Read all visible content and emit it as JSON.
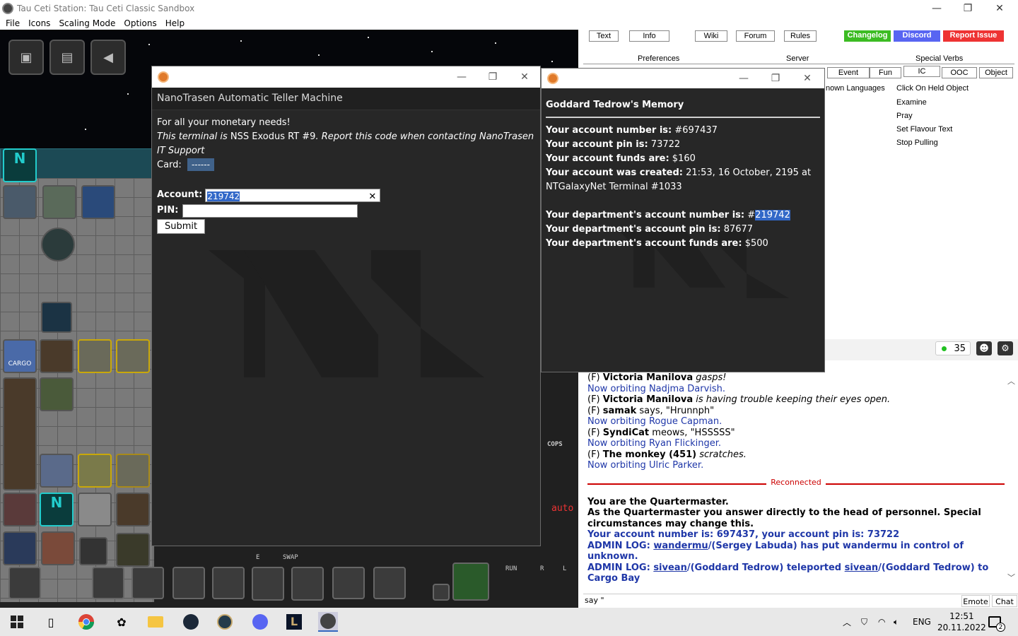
{
  "window": {
    "title": "Tau Ceti Station: Tau Ceti Classic Sandbox",
    "minimize": "—",
    "maximize": "❐",
    "close": "✕"
  },
  "menu": [
    "File",
    "Icons",
    "Scaling Mode",
    "Options",
    "Help"
  ],
  "game": {
    "cargo_label": "CARGO",
    "swap_label": "SWAP",
    "run_label": "RUN",
    "cops_label": "COPS",
    "auto_label": "auto",
    "e_label": "E",
    "r_label": "R",
    "l_label": "L"
  },
  "atm": {
    "header": "NanoTrasen Automatic Teller Machine",
    "line1": "For all your monetary needs!",
    "line2_italic_a": "This terminal is ",
    "line2_normal": "NSS Exodus RT #9",
    "line2_italic_b": ". Report this code when contacting NanoTrasen IT Support",
    "card_label": "Card:",
    "card_value": "------",
    "account_label": "Account:",
    "account_value": "219742",
    "pin_label": "PIN:",
    "pin_value": "",
    "clear_icon": "✕",
    "submit_label": "Submit"
  },
  "memory": {
    "title": "Goddard Tedrow's Memory",
    "account_number_label": "Your account number is:",
    "account_number": "#697437",
    "account_pin_label": "Your account pin is:",
    "account_pin": "73722",
    "account_funds_label": "Your account funds are:",
    "account_funds": "$160",
    "created_label": "Your account was created:",
    "created_value": "21:53, 16 October, 2195 at",
    "created_terminal": "NTGalaxyNet Terminal #1033",
    "dept_number_label": "Your department's account number is:",
    "dept_number_hash": "#",
    "dept_number": "219742",
    "dept_pin_label": "Your department's account pin is:",
    "dept_pin": "87677",
    "dept_funds_label": "Your department's account funds are:",
    "dept_funds": "$500"
  },
  "panel": {
    "top_buttons": [
      "Text",
      "Info",
      "Wiki",
      "Forum",
      "Rules"
    ],
    "changelog": "Changelog",
    "discord": "Discord",
    "report": "Report Issue",
    "tabs_row1": [
      "Preferences",
      "Server",
      "Special Verbs"
    ],
    "tabs_row2": [
      "Event",
      "Fun",
      "IC",
      "OOC",
      "Object"
    ],
    "known_languages": "nown Languages",
    "verbs": [
      "Click On Held Object",
      "Examine",
      "Pray",
      "Set Flavour Text",
      "Stop Pulling"
    ],
    "online_count": "35",
    "face_icon": "☻",
    "gear_icon": "⚙"
  },
  "chat": {
    "lines": [
      {
        "prefix": "(F) ",
        "name": "Victoria Manilova",
        "text": " gasps!",
        "style": "emote"
      },
      {
        "text": "Now orbiting Nadjma Darvish.",
        "style": "blue"
      },
      {
        "prefix": "(F) ",
        "name": "Victoria Manilova",
        "text": " is having trouble keeping their eyes open.",
        "style": "emote"
      },
      {
        "prefix": "(F) ",
        "name": "samak",
        "text": " says, \"Hrunnph\"",
        "style": "say"
      },
      {
        "text": "Now orbiting Rogue Capman.",
        "style": "blue"
      },
      {
        "prefix": "(F) ",
        "name": "SyndiCat",
        "text": " meows, \"HSSSSS\"",
        "style": "say"
      },
      {
        "text": "Now orbiting Ryan Flickinger.",
        "style": "blue"
      },
      {
        "prefix": "(F) ",
        "name": "The monkey (451)",
        "text": " scratches.",
        "style": "emote"
      },
      {
        "text": "Now orbiting Ulric Parker.",
        "style": "blue"
      }
    ],
    "reconnected": "Reconnected",
    "role_line": "You are the Quartermaster.",
    "role_desc": "As the Quartermaster you answer directly to the head of personnel. Special circumstances may change this.",
    "account_line": "Your account number is: 697437, your account pin is: 73722",
    "admin1_prefix": "ADMIN LOG: ",
    "admin1_link": "wandermu",
    "admin1_text": "/(Sergey Labuda) has put wandermu in control of unknown.",
    "admin2_prefix": "ADMIN LOG: ",
    "admin2_link1": "sivean",
    "admin2_mid": "/(Goddard Tedrow) teleported ",
    "admin2_link2": "sivean",
    "admin2_end": "/(Goddard Tedrow) to Cargo Bay"
  },
  "input": {
    "value": "say \"",
    "emote": "Emote",
    "chat": "Chat"
  },
  "taskbar": {
    "lang": "ENG",
    "time": "12:51",
    "date": "20.11.2022",
    "notif_count": "2"
  }
}
